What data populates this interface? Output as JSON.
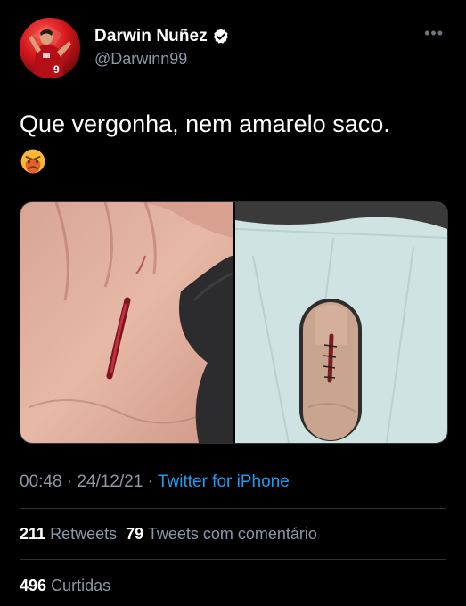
{
  "author": {
    "display_name": "Darwin Nuñez",
    "handle": "@Darwinn99",
    "verified_icon": "verified-badge-icon"
  },
  "menu": {
    "more_label": "•••"
  },
  "tweet": {
    "text": "Que vergonha, nem amarelo saco.",
    "emoji": "angry-face-emoji"
  },
  "media": {
    "images": [
      {
        "name": "injured-foot-photo"
      },
      {
        "name": "stitched-foot-photo"
      }
    ]
  },
  "meta": {
    "time": "00:48",
    "separator1": " · ",
    "date": "24/12/21",
    "separator2": " · ",
    "source": "Twitter for iPhone"
  },
  "stats": {
    "retweets_count": "211",
    "retweets_label": "Retweets",
    "quotes_count": "79",
    "quotes_label": "Tweets com comentário",
    "likes_count": "496",
    "likes_label": "Curtidas"
  },
  "colors": {
    "background": "#000000",
    "text_primary": "#ffffff",
    "text_secondary": "#8b98a5",
    "link": "#1d9bf0",
    "verified": "#ffffff",
    "divider": "#2f3336"
  }
}
